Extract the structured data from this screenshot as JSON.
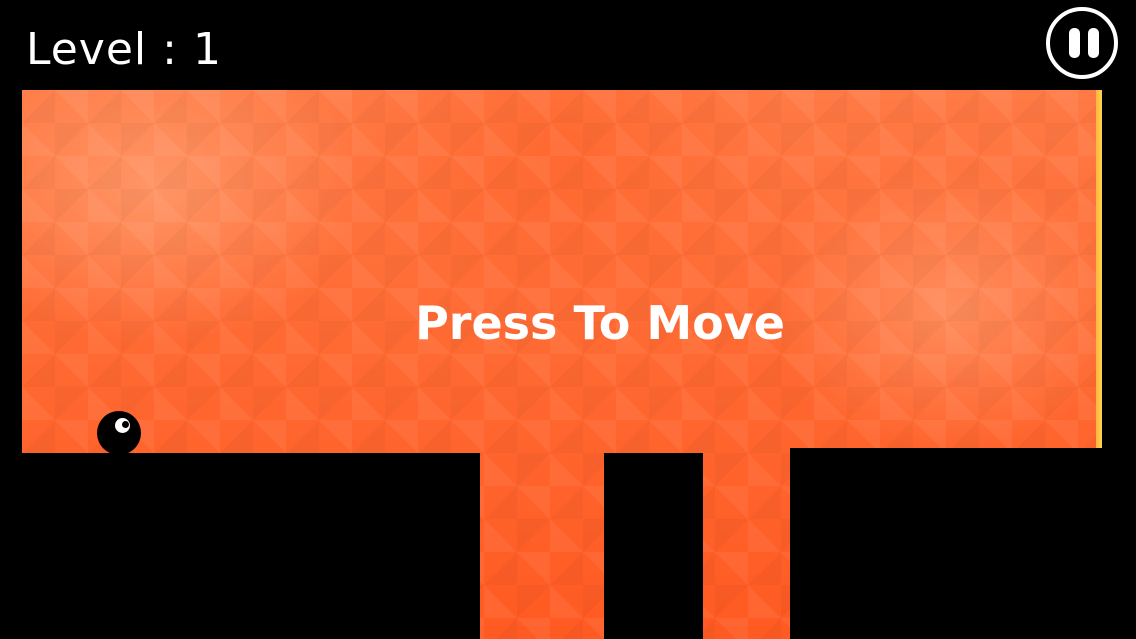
{
  "hud": {
    "level_text": "Level : 1",
    "pause_icon": "pause-icon"
  },
  "overlay": {
    "hint": "Press To Move"
  },
  "colors": {
    "background": "#000000",
    "field_orange": "#ff6a33",
    "goal_edge": "#ffc23f",
    "text": "#ffffff"
  }
}
